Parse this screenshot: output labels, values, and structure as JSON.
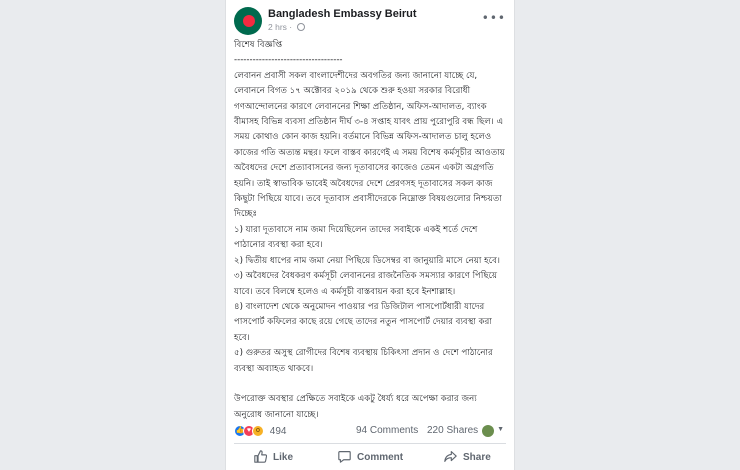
{
  "post": {
    "page_name": "Bangladesh Embassy Beirut",
    "time": "2 hrs",
    "meta_separator": "·",
    "paragraphs": [
      "বিশেষ বিজ্ঞপ্তি",
      "-----------------------------------",
      "লেবানন প্রবাসী সকল বাংলাদেশীদের অবগতির জন্য জানানো যাচ্ছে যে, লেবাননে বিগত ১৭ অক্টোবর ২০১৯ থেকে শুরু হওয়া সরকার বিরোধী গণআন্দোলনের কারণে লেবাননের শিক্ষা প্রতিষ্ঠান, অফিস-আদালত, ব্যাংক বীমাসহ বিভিন্ন ব্যবসা প্রতিষ্ঠান দীর্ঘ ৩-৪ সপ্তাহ যাবৎ প্রায় পুরোপুরি বন্ধ ছিল। এ সময় কোথাও কোন কাজ হয়নি। বর্তমানে বিভিন্ন অফিস-আদালত চালু হলেও কাজের গতি অত্যন্ত মন্থর। ফলে বাস্তব কারণেই এ সময় বিশেষ কর্মসূচীর আওতায় অবৈধদের দেশে প্রত্যাবাসনের জন্য দূতাবাসের কাজেও তেমন একটা অগ্রগতি হয়নি। তাই স্বাভাবিক ভাবেই অবৈধদের দেশে প্রেরণসহ দূতাবাসের সকল কাজ কিছুটা পিছিয়ে যাবে। তবে দূতাবাস প্রবাসীদেরকে নিম্নোক্ত বিষয়গুলোর নিশ্চয়তা দিচ্ছেঃ",
      " ১) যারা দূতাবাসে নাম জমা দিয়েছিলেন তাদের সবাইকে একই শর্তে দেশে পাঠানোর ব্যবস্থা করা হবে।",
      "২) দ্বিতীয় ধাপের নাম জমা নেয়া পিছিয়ে ডিসেম্বর বা জানুয়ারি মাসে নেয়া হবে।",
      "৩) অবৈধদের বৈধকরণ কর্মসূচী লেবাননের রাজনৈতিক সমস্যার কারণে পিছিয়ে যাবে। তবে বিলম্বে হলেও এ কর্মসূচী বাস্তবায়ন করা হবে ইনশাল্লাহ।",
      "৪) বাংলাদেশ থেকে অনুমোদন পাওয়ার পর ডিজিটাল পাসপোর্টধারী যাদের পাসপোর্ট কফিলের কাছে রয়ে গেছে তাদের নতুন পাসপোর্ট দেয়ার ব্যবস্থা করা হবে।",
      "৫) গুরুতর অসুস্থ রোগীদের বিশেষ ব্যবস্থায় চিকিৎসা প্রদান ও দেশে পাঠানোর ব্যবস্থা অব্যাহত থাকবে।",
      "",
      "উপরোক্ত অবস্থার প্রেক্ষিতে সবাইকে একটু ধৈর্য্য ধরে অপেক্ষা করার জন্য অনুরোধ জানানো যাচ্ছে।"
    ]
  },
  "stats": {
    "reactions": "494",
    "comments": "94 Comments",
    "shares": "220 Shares"
  },
  "actions": {
    "like": "Like",
    "comment": "Comment",
    "share": "Share"
  },
  "icons": [
    "avatar-flag",
    "globe-icon",
    "more-options-icon",
    "like-reaction-icon",
    "love-reaction-icon",
    "wow-reaction-icon",
    "thumbs-up-icon",
    "comment-icon",
    "share-icon"
  ],
  "colors": {
    "flag_green": "#006a4e",
    "flag_red": "#f42a41",
    "like_blue": "#1877f2",
    "love_red": "#f33e58",
    "wow_yellow": "#f7b125",
    "muted_text": "#606770",
    "page_bg": "#e9ebee"
  }
}
